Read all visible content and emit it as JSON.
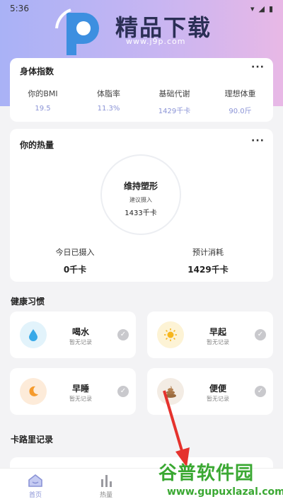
{
  "status_bar": {
    "time": "5:36"
  },
  "watermark_top": {
    "title": "精品下载",
    "url": "www.j9p.com"
  },
  "bmi_card": {
    "title": "身体指数",
    "more": "···",
    "items": [
      {
        "label": "你的BMI",
        "value": "19.5"
      },
      {
        "label": "体脂率",
        "value": "11.3%"
      },
      {
        "label": "基础代谢",
        "value": "1429千卡"
      },
      {
        "label": "理想体重",
        "value": "90.0斤"
      }
    ]
  },
  "calorie_card": {
    "title": "你的热量",
    "more": "···",
    "ring_title": "维持塑形",
    "ring_sub": "建议摄入",
    "ring_value": "1433千卡",
    "intake_label": "今日已摄入",
    "intake_value": "0千卡",
    "burn_label": "预计消耗",
    "burn_value": "1429千卡"
  },
  "habits": {
    "title": "健康习惯",
    "items": [
      {
        "name": "喝水",
        "status": "暂无记录",
        "icon": "water-drop-icon",
        "bg": "#e2f3fb"
      },
      {
        "name": "早起",
        "status": "暂无记录",
        "icon": "sun-icon",
        "bg": "#fdf3d5"
      },
      {
        "name": "早睡",
        "status": "暂无记录",
        "icon": "moon-icon",
        "bg": "#fdebd9"
      },
      {
        "name": "便便",
        "status": "暂无记录",
        "icon": "poop-icon",
        "bg": "#f3ece4"
      }
    ]
  },
  "calorie_record": {
    "title": "卡路里记录"
  },
  "tabbar": {
    "tabs": [
      {
        "label": "首页",
        "active": true,
        "icon": "home-icon"
      },
      {
        "label": "热量",
        "active": false,
        "icon": "bar-chart-icon"
      }
    ]
  },
  "watermark_bottom": {
    "title": "谷普软件园",
    "url": "www.gupuxlazal.com"
  },
  "colors": {
    "accent": "#8a93d6",
    "active_tab": "#8a93d6",
    "watermark_green": "#3aa832",
    "arrow_red": "#e5322d"
  }
}
